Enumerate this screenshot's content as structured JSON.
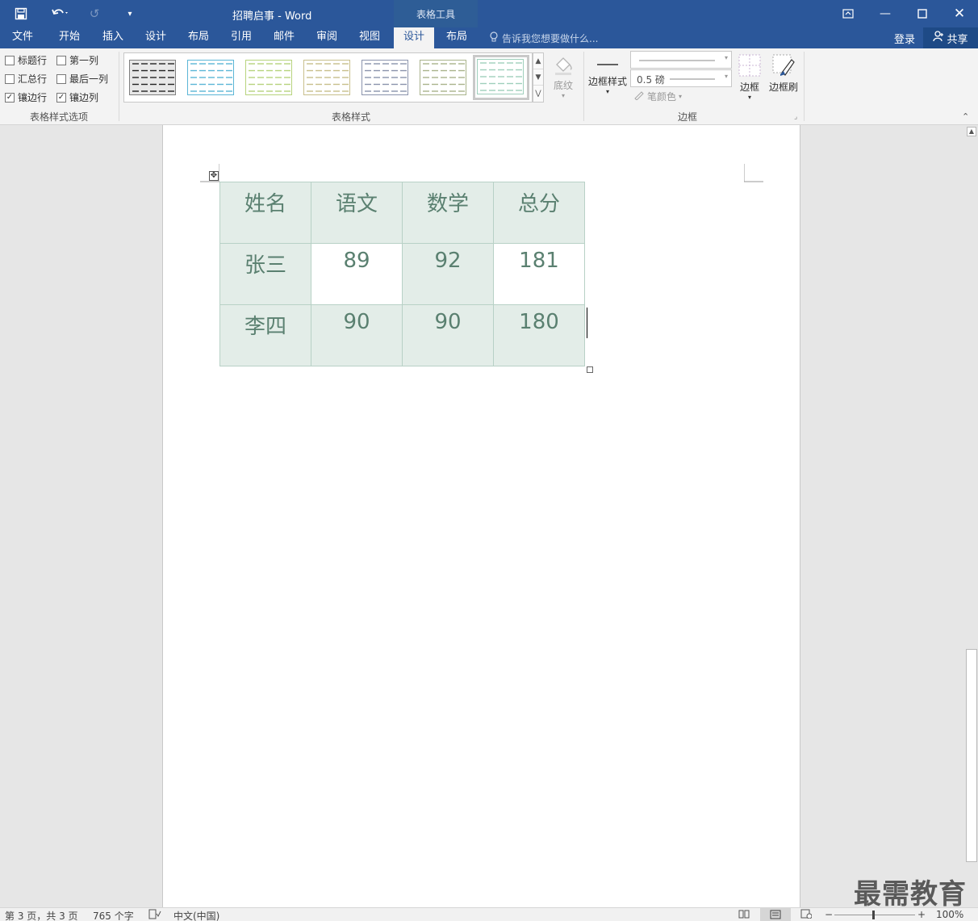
{
  "titlebar": {
    "title": "招聘启事 - Word",
    "context_tab": "表格工具"
  },
  "tabs": [
    {
      "label": "文件"
    },
    {
      "label": "开始"
    },
    {
      "label": "插入"
    },
    {
      "label": "设计"
    },
    {
      "label": "布局"
    },
    {
      "label": "引用"
    },
    {
      "label": "邮件"
    },
    {
      "label": "审阅"
    },
    {
      "label": "视图"
    },
    {
      "label": "设计",
      "active": true
    },
    {
      "label": "布局"
    }
  ],
  "tellme": {
    "text": "告诉我您想要做什么..."
  },
  "account": {
    "login": "登录",
    "share": "共享"
  },
  "ribbon": {
    "style_options": {
      "label": "表格样式选项",
      "options": [
        {
          "label": "标题行",
          "checked": false
        },
        {
          "label": "第一列",
          "checked": false
        },
        {
          "label": "汇总行",
          "checked": false
        },
        {
          "label": "最后一列",
          "checked": false
        },
        {
          "label": "镶边行",
          "checked": true
        },
        {
          "label": "镶边列",
          "checked": true
        }
      ]
    },
    "table_styles": {
      "label": "表格样式",
      "shading": "底纹",
      "swatch_colors": [
        "#7f7f7f",
        "#5bb6d6",
        "#b7d37d",
        "#c8bf8c",
        "#8a93ac",
        "#a9b38b",
        "#9fcfbc"
      ],
      "selected_index": 6
    },
    "borders": {
      "label": "边框",
      "border_styles": "边框样式",
      "weight": "0.5 磅",
      "pen_color": "笔颜色",
      "borders": "边框",
      "border_painter": "边框刷"
    }
  },
  "document": {
    "table": [
      [
        "姓名",
        "语文",
        "数学",
        "总分"
      ],
      [
        "张三",
        "89",
        "92",
        "181"
      ],
      [
        "李四",
        "90",
        "90",
        "180"
      ]
    ],
    "table_color": "#5a8070",
    "band_color": "#e3ede8"
  },
  "statusbar": {
    "page": "第 3 页，共 3 页",
    "words": "765 个字",
    "language": "中文(中国)",
    "zoom": "100%"
  },
  "watermark": "最需教育"
}
